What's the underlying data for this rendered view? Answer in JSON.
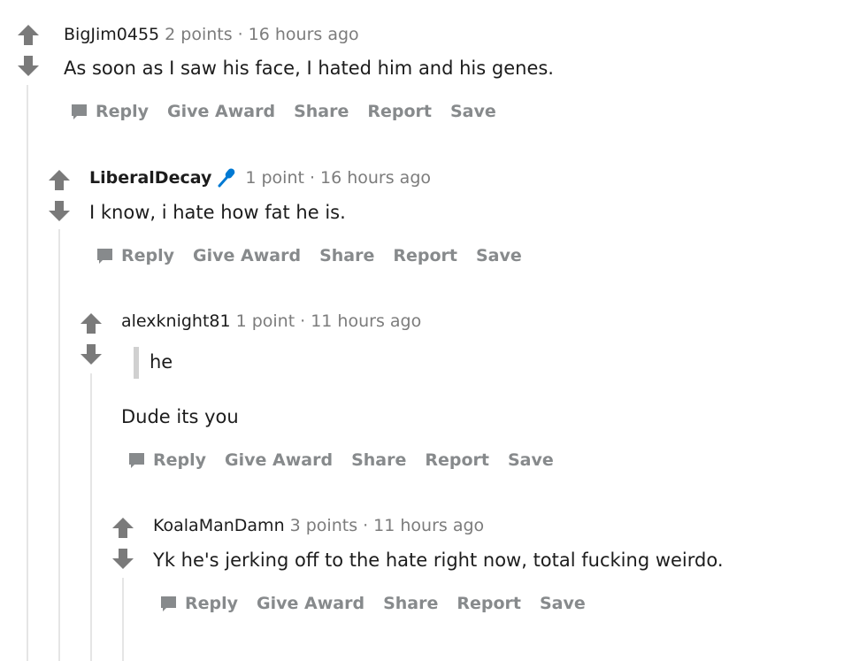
{
  "colors": {
    "text": "#1c1c1c",
    "meta": "#7c7c7c",
    "actions": "#878a8c",
    "vote_arrow": "#7a7a7a",
    "thread_line": "#e5e5e5",
    "flair": "#0079d3"
  },
  "icons": {
    "upvote": "up-arrow-icon",
    "downvote": "down-arrow-icon",
    "reply": "speech-bubble-icon",
    "flair": "microphone-icon"
  },
  "comments": [
    {
      "author": "BigJim0455",
      "points": "2 points",
      "separator": "·",
      "time": "16 hours ago",
      "text": "As soon as I saw his face, I hated him and his genes.",
      "actions": {
        "reply": "Reply",
        "give_award": "Give Award",
        "share": "Share",
        "report": "Report",
        "save": "Save"
      }
    },
    {
      "author": "LiberalDecay",
      "has_flair": true,
      "points": "1 point",
      "separator": "·",
      "time": "16 hours ago",
      "text": "I know, i hate how fat he is.",
      "actions": {
        "reply": "Reply",
        "give_award": "Give Award",
        "share": "Share",
        "report": "Report",
        "save": "Save"
      }
    },
    {
      "author": "alexknight81",
      "points": "1 point",
      "separator": "·",
      "time": "11 hours ago",
      "quote": "he",
      "text": "Dude its you",
      "actions": {
        "reply": "Reply",
        "give_award": "Give Award",
        "share": "Share",
        "report": "Report",
        "save": "Save"
      }
    },
    {
      "author": "KoalaManDamn",
      "points": "3 points",
      "separator": "·",
      "time": "11 hours ago",
      "text": "Yk he's jerking off to the hate right now, total fucking weirdo.",
      "actions": {
        "reply": "Reply",
        "give_award": "Give Award",
        "share": "Share",
        "report": "Report",
        "save": "Save"
      }
    }
  ]
}
